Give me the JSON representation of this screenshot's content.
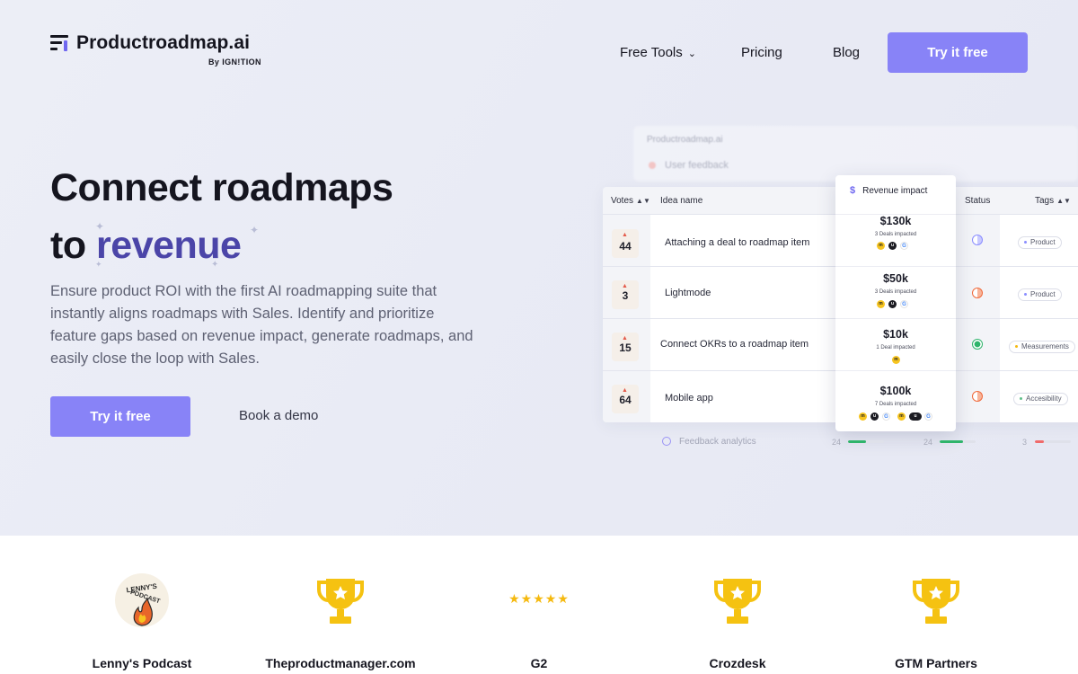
{
  "brand": {
    "name": "Productroadmap.ai",
    "by": "By IGN!TION"
  },
  "nav": {
    "free_tools": "Free Tools",
    "pricing": "Pricing",
    "blog": "Blog",
    "cta": "Try it free"
  },
  "hero": {
    "title_line1": "Connect roadmaps",
    "title_line2_prefix": "to ",
    "title_line2_accent": "revenue",
    "lead": "Ensure product ROI with the first AI roadmapping suite that instantly aligns roadmaps with Sales. Identify and prioritize feature gaps based on revenue impact, generate roadmaps, and easily close the loop with Sales.",
    "primary_cta": "Try it free",
    "secondary_cta": "Book a demo"
  },
  "mockup": {
    "ghost_title": "Productroadmap.ai",
    "ghost_filter": "User feedback",
    "columns": {
      "votes": "Votes",
      "idea": "Idea name",
      "revenue": "Revenue impact",
      "status": "Status",
      "tags": "Tags"
    },
    "rows": [
      {
        "votes": "44",
        "idea": "Attaching a deal to roadmap item",
        "revenue": "$130k",
        "deals": "3 Deals impacted",
        "status_color": "#8a8dff",
        "tag": "Product"
      },
      {
        "votes": "3",
        "idea": "Lightmode",
        "revenue": "$50k",
        "deals": "3 Deals impacted",
        "status_color": "#f06a3c",
        "tag": "Product"
      },
      {
        "votes": "15",
        "idea": "Connect OKRs to a roadmap item",
        "revenue": "$10k",
        "deals": "1 Deal impacted",
        "status_color": "#2fb46b",
        "tag": "Measurements"
      },
      {
        "votes": "64",
        "idea": "Mobile app",
        "revenue": "$100k",
        "deals": "7 Deals impacted",
        "status_color": "#f06a3c",
        "tag": "Accesibility"
      }
    ],
    "footer_label": "Feedback analytics",
    "footer_values": [
      "24",
      "24",
      "3"
    ]
  },
  "awards": [
    {
      "label": "Lenny's Podcast",
      "icon": "podcast-logo"
    },
    {
      "label": "Theproductmanager.com",
      "icon": "trophy-icon"
    },
    {
      "label": "G2",
      "icon": "stars-icon"
    },
    {
      "label": "Crozdesk",
      "icon": "trophy-icon"
    },
    {
      "label": "GTM Partners",
      "icon": "trophy-icon"
    }
  ],
  "colors": {
    "accent": "#8883f7",
    "accent_text": "#4b45a8",
    "gold": "#f5b90f"
  }
}
